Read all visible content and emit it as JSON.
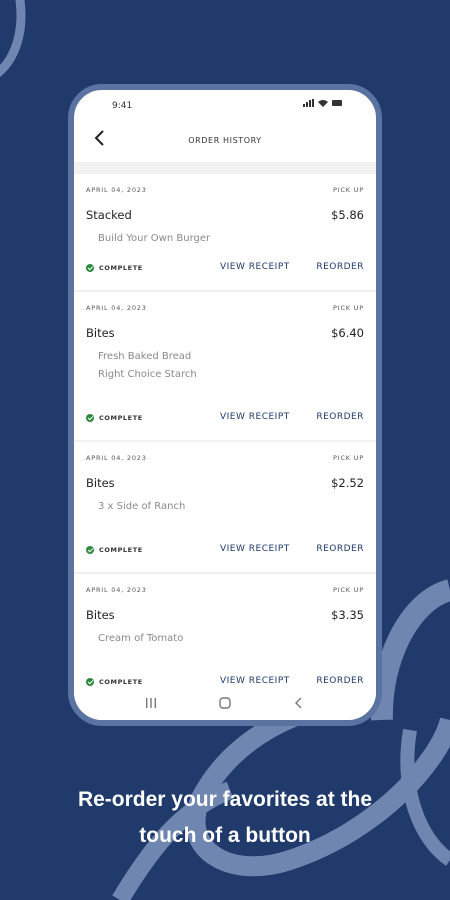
{
  "status_bar": {
    "time": "9:41"
  },
  "header": {
    "title": "ORDER HISTORY"
  },
  "orders": [
    {
      "date": "APRIL 04, 2023",
      "type": "PICK UP",
      "name": "Stacked",
      "price": "$5.86",
      "items": [
        "Build Your Own Burger"
      ],
      "status": "COMPLETE",
      "receipt_label": "VIEW RECEIPT",
      "reorder_label": "REORDER"
    },
    {
      "date": "APRIL 04, 2023",
      "type": "PICK UP",
      "name": "Bites",
      "price": "$6.40",
      "items": [
        "Fresh Baked Bread",
        "Right Choice Starch"
      ],
      "status": "COMPLETE",
      "receipt_label": "VIEW RECEIPT",
      "reorder_label": "REORDER"
    },
    {
      "date": "APRIL 04, 2023",
      "type": "PICK UP",
      "name": "Bites",
      "price": "$2.52",
      "items": [
        "3 x Side of Ranch"
      ],
      "status": "COMPLETE",
      "receipt_label": "VIEW RECEIPT",
      "reorder_label": "REORDER"
    },
    {
      "date": "APRIL 04, 2023",
      "type": "PICK UP",
      "name": "Bites",
      "price": "$3.35",
      "items": [
        "Cream of Tomato"
      ],
      "status": "COMPLETE",
      "receipt_label": "VIEW RECEIPT",
      "reorder_label": "REORDER"
    }
  ],
  "caption": {
    "line1": "Re-order your favorites at the",
    "line2": "touch of a button"
  },
  "icons": {
    "back": "chevron-left-icon",
    "nav_recents": "recents-icon",
    "nav_home": "home-icon",
    "nav_back": "back-icon",
    "complete": "check-circle-icon"
  },
  "colors": {
    "background": "#1f3a6b",
    "accent": "#1f3a6b",
    "complete": "#2d8a3e"
  }
}
